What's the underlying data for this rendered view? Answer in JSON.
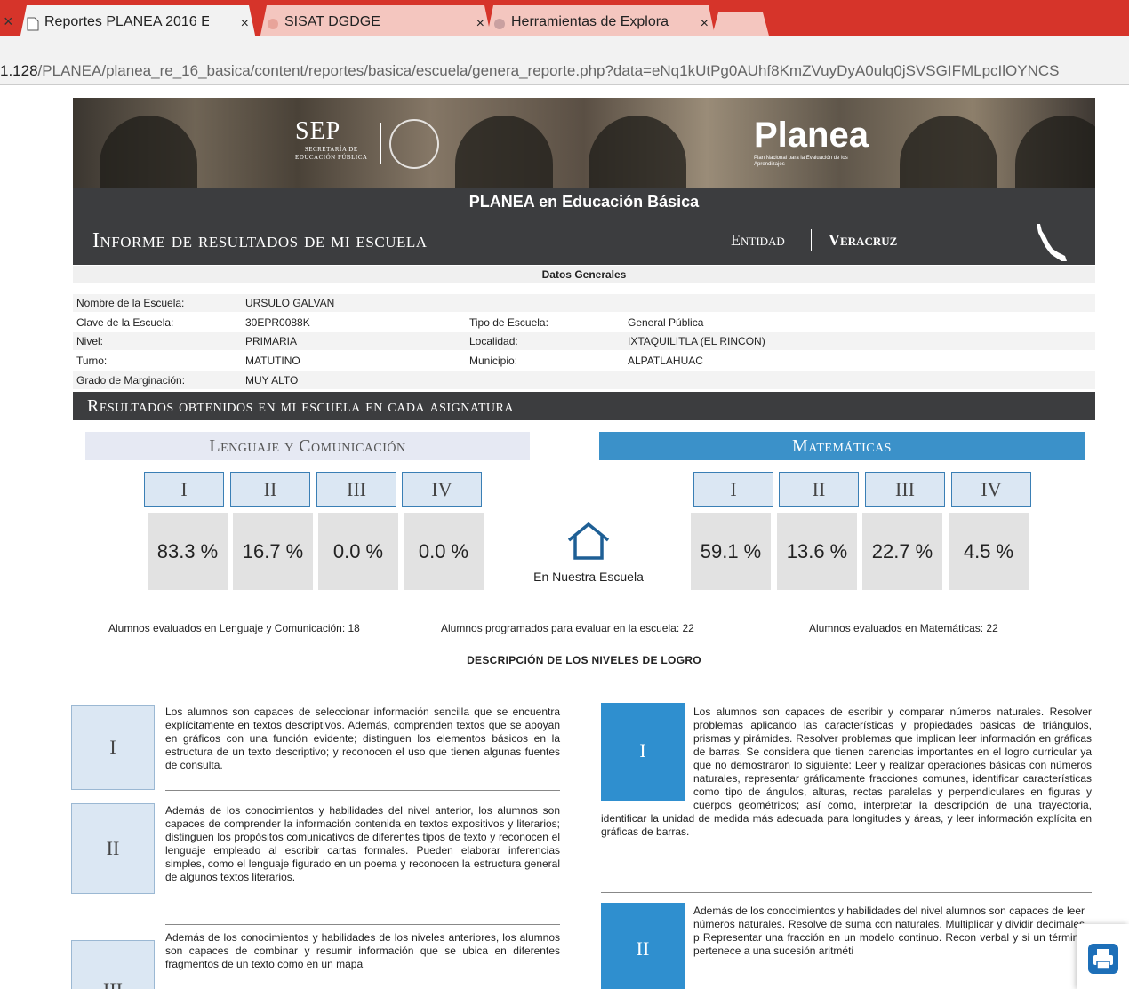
{
  "browser": {
    "tabs": [
      {
        "label": "Reportes PLANEA 2016 E",
        "active": true
      },
      {
        "label": "SISAT DGDGE",
        "active": false
      },
      {
        "label": "Herramientas de Explora",
        "active": false
      }
    ],
    "tab_close": "×",
    "url_host": "1.128",
    "url_path": "/PLANEA/planea_re_16_basica/content/reportes/basica/escuela/genera_reporte.php?data=eNq1kUtPg0AUhf8KmZVuyDyA0ulq0jSVSGIFMLpcIlOYNCS"
  },
  "banner": {
    "sep_main": "SEP",
    "sep_sub_1": "SECRETARÍA DE",
    "sep_sub_2": "EDUCACIÓN PÚBLICA",
    "planea_main": "Planea",
    "planea_sub": "Plan Nacional para la Evaluación de los Aprendizajes"
  },
  "header": {
    "subtitle": "PLANEA en Educación Básica",
    "title": "Informe de resultados de mi escuela",
    "entidad_label": "Entidad",
    "entidad_value": "Veracruz"
  },
  "datos": {
    "title": "Datos Generales",
    "nombre_label": "Nombre de la Escuela:",
    "nombre_value": "URSULO GALVAN",
    "clave_label": "Clave de la Escuela:",
    "clave_value": "30EPR0088K",
    "tipo_label": "Tipo de Escuela:",
    "tipo_value": "General Pública",
    "nivel_label": "Nivel:",
    "nivel_value": "PRIMARIA",
    "localidad_label": "Localidad:",
    "localidad_value": "IXTAQUILITLA (EL RINCON)",
    "turno_label": "Turno:",
    "turno_value": "MATUTINO",
    "municipio_label": "Municipio:",
    "municipio_value": "ALPATLAHUAC",
    "grado_label": "Grado de Marginación:",
    "grado_value": "MUY ALTO"
  },
  "resultados": {
    "title": "Resultados obtenidos en mi escuela en cada asignatura",
    "lenguaje": {
      "title": "Lenguaje y Comunicación",
      "levels": [
        "I",
        "II",
        "III",
        "IV"
      ],
      "percents": [
        "83.3 %",
        "16.7 %",
        "0.0 %",
        "0.0 %"
      ]
    },
    "matematicas": {
      "title": "Matemáticas",
      "levels": [
        "I",
        "II",
        "III",
        "IV"
      ],
      "percents": [
        "59.1 %",
        "13.6 %",
        "22.7 %",
        "4.5 %"
      ]
    },
    "center_label": "En Nuestra Escuela",
    "stat_lang": "Alumnos evaluados en Lenguaje y Comunicación: 18",
    "stat_prog": "Alumnos programados para evaluar en la escuela: 22",
    "stat_mat": "Alumnos evaluados en Matemáticas: 22"
  },
  "descripcion": {
    "title": "DESCRIPCIÓN DE LOS NIVELES DE LOGRO",
    "lenguaje": [
      {
        "level": "I",
        "text": "Los alumnos son capaces de seleccionar información sencilla que se encuentra explícitamente en textos descriptivos. Además, comprenden textos que se apoyan en gráficos con una función evidente; distinguen los elementos básicos en la estructura de un texto descriptivo; y reconocen el uso que tienen algunas fuentes de consulta."
      },
      {
        "level": "II",
        "text": "Además de los conocimientos y habilidades del nivel anterior, los alumnos son capaces de comprender la información contenida en textos expositivos y literarios; distinguen los propósitos comunicativos de diferentes tipos de texto y reconocen el lenguaje empleado al escribir cartas formales. Pueden elaborar inferencias simples, como el lenguaje figurado en un poema y reconocen la estructura general de algunos textos literarios."
      },
      {
        "level": "III",
        "text": "Además de los conocimientos y habilidades de los niveles anteriores, los alumnos son capaces de combinar y resumir información que se ubica en diferentes fragmentos de un texto como en un mapa"
      }
    ],
    "matematicas": [
      {
        "level": "I",
        "text": "Los alumnos son capaces de escribir y comparar números naturales. Resolver problemas aplicando las características y propiedades básicas de triángulos, prismas y pirámides. Resolver problemas que implican leer información en gráficas de barras. Se considera que tienen carencias importantes en el logro curricular ya que no demostraron lo siguiente: Leer y realizar operaciones básicas con números naturales, representar gráficamente fracciones comunes, identificar características como tipo de ángulos, alturas, rectas paralelas y perpendiculares en figuras y cuerpos geométricos; así como, interpretar la descripción de una trayectoria, identificar la unidad de medida más adecuada para longitudes y áreas, y leer información explícita en gráficas de barras."
      },
      {
        "level": "II",
        "text": "Además de los conocimientos y habilidades del nivel alumnos son capaces de leer números naturales. Resolve de suma con naturales. Multiplicar y dividir decimales p Representar una fracción en un modelo continuo. Recon verbal y si un término pertenece a una sucesión aritméti"
      }
    ]
  },
  "colors": {
    "tab_bar": "#d6342a",
    "header_dark": "#3c3d3f",
    "mat_blue": "#3b91c9",
    "lang_light": "#e6e9f3"
  }
}
